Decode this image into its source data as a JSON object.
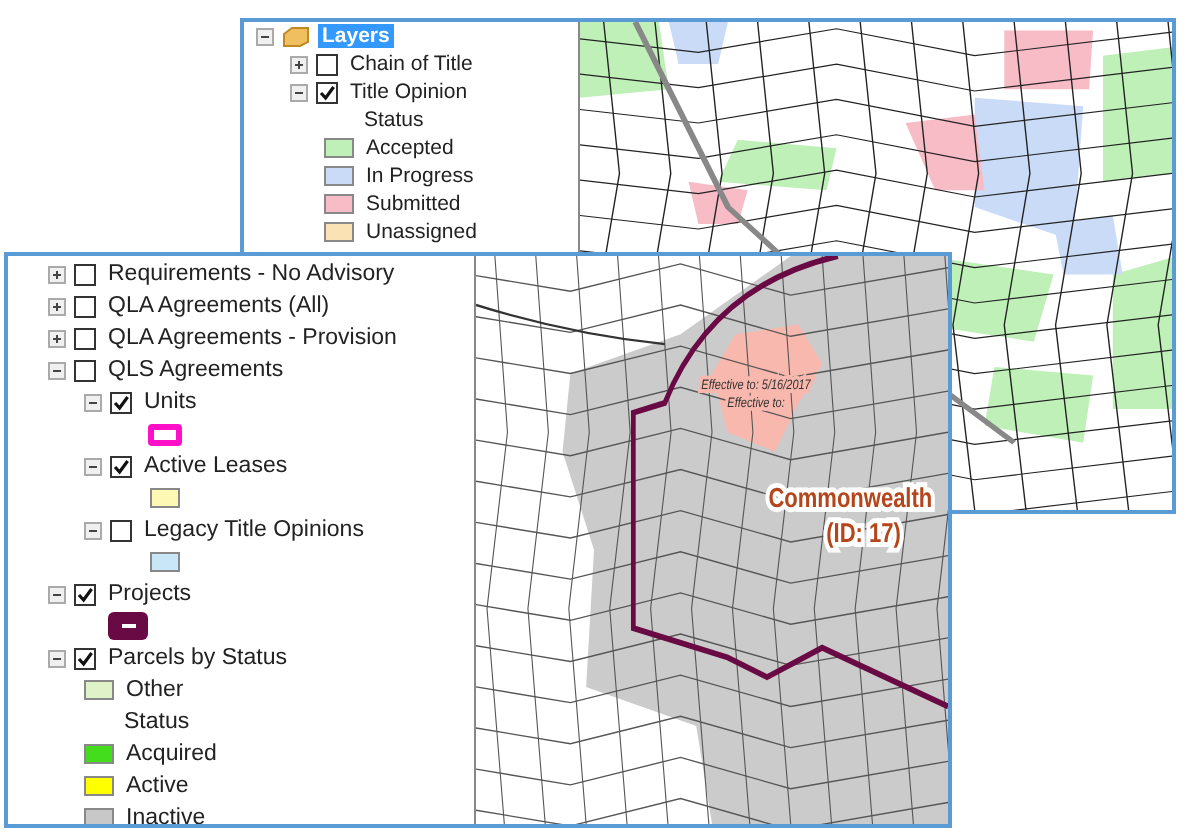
{
  "windows": [
    {
      "legend": [
        {
          "kind": "root",
          "label": "Layers",
          "expanded": true,
          "selected": true,
          "children": [
            {
              "kind": "layer",
              "label": "Chain of Title",
              "expanded": false,
              "checked": false
            },
            {
              "kind": "layer",
              "label": "Title Opinion",
              "expanded": true,
              "checked": true,
              "children": [
                {
                  "kind": "heading",
                  "label": "Status"
                },
                {
                  "kind": "class",
                  "label": "Accepted",
                  "color": "#bff0b8"
                },
                {
                  "kind": "class",
                  "label": "In Progress",
                  "color": "#c9dbf7"
                },
                {
                  "kind": "class",
                  "label": "Submitted",
                  "color": "#f7bcc6"
                },
                {
                  "kind": "class",
                  "label": "Unassigned",
                  "color": "#fbe2b4"
                }
              ]
            }
          ]
        }
      ],
      "map": {
        "kind": "status"
      }
    },
    {
      "legend": [
        {
          "kind": "layer",
          "label": "Requirements - No Advisory",
          "expanded": false,
          "checked": false
        },
        {
          "kind": "layer",
          "label": "QLA Agreements (All)",
          "expanded": false,
          "checked": false
        },
        {
          "kind": "layer",
          "label": "QLA Agreements - Provision",
          "expanded": false,
          "checked": false
        },
        {
          "kind": "layer",
          "label": "QLS Agreements",
          "expanded": true,
          "checked": false,
          "children": [
            {
              "kind": "layer",
              "label": "Units",
              "expanded": true,
              "checked": true,
              "children": [
                {
                  "kind": "outline",
                  "color": "#ff10c8"
                }
              ]
            },
            {
              "kind": "layer",
              "label": "Active Leases",
              "expanded": true,
              "checked": true,
              "children": [
                {
                  "kind": "fill",
                  "color": "#fdf8b4"
                }
              ]
            },
            {
              "kind": "layer",
              "label": "Legacy Title Opinions",
              "expanded": true,
              "checked": false,
              "children": [
                {
                  "kind": "fill",
                  "color": "#c8e6f8"
                }
              ]
            }
          ]
        },
        {
          "kind": "layer",
          "label": "Projects",
          "expanded": true,
          "checked": true,
          "children": [
            {
              "kind": "line",
              "color": "#6a0a44"
            }
          ]
        },
        {
          "kind": "layer",
          "label": "Parcels by Status",
          "expanded": true,
          "checked": true,
          "children": [
            {
              "kind": "class",
              "label": "Other",
              "color": "#e0f2c8"
            },
            {
              "kind": "heading",
              "label": "Status"
            },
            {
              "kind": "class",
              "label": "Acquired",
              "color": "#44dd1e"
            },
            {
              "kind": "class",
              "label": "Active",
              "color": "#ffff00"
            },
            {
              "kind": "class",
              "label": "Inactive",
              "color": "#c8c8c8"
            }
          ]
        }
      ],
      "map": {
        "kind": "project",
        "labels": [
          "Effective to: 5/16/2017",
          "Effective to:"
        ],
        "project_name": "Commonwealth",
        "project_id": "(ID: 17)"
      }
    }
  ]
}
